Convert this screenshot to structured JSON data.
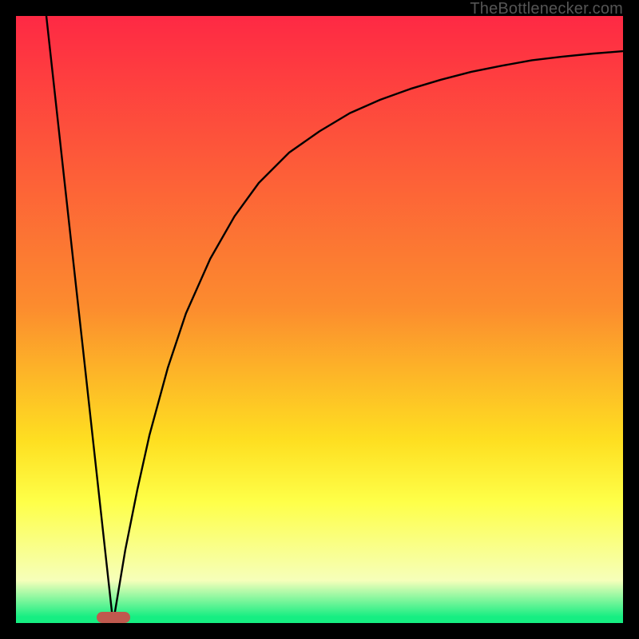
{
  "credit": "TheBottlenecker.com",
  "colors": {
    "bg_top": "#fe2944",
    "bg_mid1": "#fc8c2e",
    "bg_mid2": "#fedf21",
    "bg_mid3": "#feff48",
    "bg_mid4": "#f6ffba",
    "bg_bottom": "#16ee82",
    "curve": "#000000",
    "frame": "#000000",
    "marker": "#c0594e"
  },
  "chart_data": {
    "type": "line",
    "title": "",
    "xlabel": "",
    "ylabel": "",
    "xlim": [
      0,
      100
    ],
    "ylim": [
      0,
      100
    ],
    "x_minimum": 16,
    "gradient_stops": [
      {
        "pct": 0,
        "key": "bg_top"
      },
      {
        "pct": 48,
        "key": "bg_mid1"
      },
      {
        "pct": 70,
        "key": "bg_mid2"
      },
      {
        "pct": 80,
        "key": "bg_mid3"
      },
      {
        "pct": 93,
        "key": "bg_mid4"
      },
      {
        "pct": 99,
        "key": "bg_bottom"
      }
    ],
    "series": [
      {
        "name": "left-descent",
        "x": [
          5,
          6,
          7,
          8,
          9,
          10,
          11,
          12,
          13,
          14,
          15,
          16
        ],
        "values": [
          100,
          90.9,
          81.8,
          72.7,
          63.6,
          54.5,
          45.5,
          36.4,
          27.3,
          18.2,
          9.1,
          0
        ]
      },
      {
        "name": "right-ascent",
        "x": [
          16,
          18,
          20,
          22,
          25,
          28,
          32,
          36,
          40,
          45,
          50,
          55,
          60,
          65,
          70,
          75,
          80,
          85,
          90,
          95,
          100
        ],
        "values": [
          0,
          12,
          22,
          31,
          42,
          51,
          60,
          67,
          72.5,
          77.5,
          81,
          84,
          86.2,
          88,
          89.5,
          90.8,
          91.8,
          92.7,
          93.3,
          93.8,
          94.2
        ]
      }
    ],
    "marker": {
      "x": 16,
      "y": 0
    }
  }
}
